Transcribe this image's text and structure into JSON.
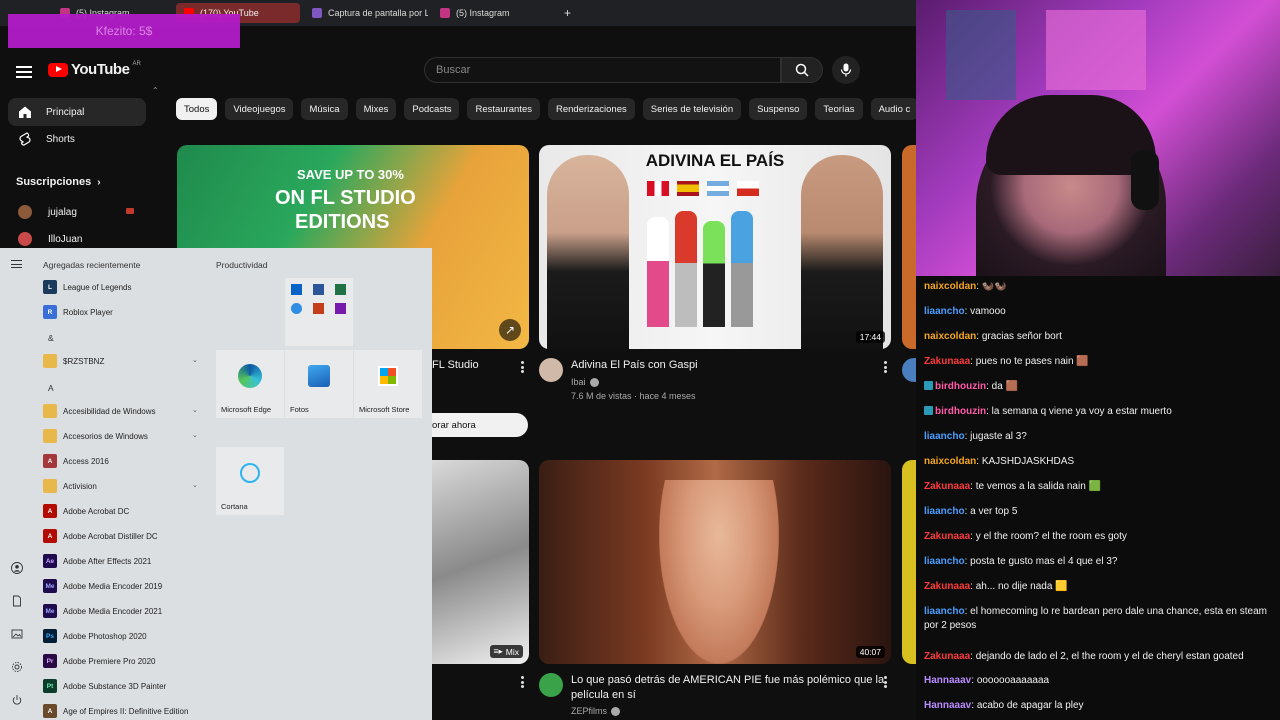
{
  "browser": {
    "tabs": [
      {
        "label": "(5) Instagram",
        "color": "#c13584"
      },
      {
        "label": "(170) YouTube",
        "color": "#ff0000",
        "active": true
      },
      {
        "label": "Captura de pantalla por Li",
        "color": "#7e57c2"
      },
      {
        "label": "(5) Instagram",
        "color": "#c13584"
      }
    ],
    "new_tab_label": "+"
  },
  "stream_overlay": "Kfezito: 5$",
  "youtube": {
    "logo_text": "YouTube",
    "region": "AR",
    "search_placeholder": "Buscar",
    "sidebar": {
      "items": [
        {
          "label": "Principal",
          "icon": "home-icon"
        },
        {
          "label": "Shorts",
          "icon": "shorts-icon"
        }
      ],
      "subscriptions_title": "Suscripciones",
      "subscriptions": [
        {
          "label": "jujalag",
          "color": "#8a5a3a"
        },
        {
          "label": "IlloJuan",
          "color": "#c94a4a"
        }
      ]
    },
    "chips": [
      "Todos",
      "Videojuegos",
      "Música",
      "Mixes",
      "Podcasts",
      "Restaurantes",
      "Renderizaciones",
      "Series de televisión",
      "Suspenso",
      "Teorías",
      "Audio c"
    ],
    "videos": [
      {
        "thumb_text_1": "SAVE UP TO 30%",
        "thumb_text_2": "ON FL STUDIO",
        "thumb_text_3": "EDITIONS",
        "title_partial": "FL Studio",
        "cta": "orar ahora"
      },
      {
        "thumb_text": "ADIVINA EL PAÍS",
        "duration": "17:44",
        "title": "Adivina El País con Gaspi",
        "channel": "Ibai",
        "meta": "7.6 M de vistas · hace 4 meses"
      },
      {
        "badge": "Mix"
      },
      {
        "duration": "40:07",
        "title_line1": "Lo que pasó detrás de AMERICAN PIE fue más polémico que la",
        "title_line2": "película en sí",
        "channel": "ZEPfilms"
      }
    ]
  },
  "start_menu": {
    "recent_header": "Agregadas recientemente",
    "productivity_header": "Productividad",
    "apps": [
      {
        "label": "League of Legends",
        "icon_color": "#1a3b5c",
        "glyph": "L"
      },
      {
        "label": "Roblox Player",
        "icon_color": "#3a6fd8",
        "glyph": "R"
      },
      {
        "label": "&",
        "type": "letter"
      },
      {
        "label": "$RZSTBNZ",
        "icon_color": "#e8b84a",
        "glyph": "",
        "folder": true
      },
      {
        "label": "A",
        "type": "letter"
      },
      {
        "label": "Accesibilidad de Windows",
        "icon_color": "#e8b84a",
        "glyph": "",
        "folder": true
      },
      {
        "label": "Accesorios de Windows",
        "icon_color": "#e8b84a",
        "glyph": "",
        "folder": true
      },
      {
        "label": "Access 2016",
        "icon_color": "#a4373a",
        "glyph": "A"
      },
      {
        "label": "Activision",
        "icon_color": "#e8b84a",
        "glyph": "",
        "folder": true
      },
      {
        "label": "Adobe Acrobat DC",
        "icon_color": "#b30b00",
        "glyph": "A"
      },
      {
        "label": "Adobe Acrobat Distiller DC",
        "icon_color": "#b30b00",
        "glyph": "A"
      },
      {
        "label": "Adobe After Effects 2021",
        "icon_color": "#1f0a4d",
        "glyph": "Ae"
      },
      {
        "label": "Adobe Media Encoder 2019",
        "icon_color": "#1f0a4d",
        "glyph": "Me"
      },
      {
        "label": "Adobe Media Encoder 2021",
        "icon_color": "#1f0a4d",
        "glyph": "Me"
      },
      {
        "label": "Adobe Photoshop 2020",
        "icon_color": "#001e36",
        "glyph": "Ps"
      },
      {
        "label": "Adobe Premiere Pro 2020",
        "icon_color": "#2a0a45",
        "glyph": "Pr"
      },
      {
        "label": "Adobe Substance 3D Painter",
        "icon_color": "#0b3d2a",
        "glyph": "Pt"
      },
      {
        "label": "Age of Empires II: Definitive Edition",
        "icon_color": "#6b4a2b",
        "glyph": "A"
      }
    ],
    "tiles": [
      {
        "label": "Microsoft Edge"
      },
      {
        "label": "Fotos"
      },
      {
        "label": "Microsoft Store"
      },
      {
        "label": "Cortana"
      }
    ]
  },
  "chat": {
    "messages": [
      {
        "user": "naixcoldan",
        "color": "#f5a623",
        "text": "🦦🦦"
      },
      {
        "user": "liaancho",
        "color": "#4a9eff",
        "text": "vamooo"
      },
      {
        "user": "naixcoldan",
        "color": "#f5a623",
        "text": "gracias señor bort"
      },
      {
        "user": "Zakunaaa",
        "color": "#ff3b3b",
        "text": "pues no te pases nain 🟫"
      },
      {
        "user": "birdhouzin",
        "color": "#ff5ca8",
        "text": "da 🟫",
        "badge": true
      },
      {
        "user": "birdhouzin",
        "color": "#ff5ca8",
        "text": "la semana q viene ya voy a estar muerto",
        "badge": true
      },
      {
        "user": "liaancho",
        "color": "#4a9eff",
        "text": "jugaste al 3?"
      },
      {
        "user": "naixcoldan",
        "color": "#f5a623",
        "text": "KAJSHDJASKHDAS"
      },
      {
        "user": "Zakunaaa",
        "color": "#ff3b3b",
        "text": "te vemos a la salida nain 🟩"
      },
      {
        "user": "liaancho",
        "color": "#4a9eff",
        "text": "a ver top 5"
      },
      {
        "user": "Zakunaaa",
        "color": "#ff3b3b",
        "text": "y el the room? el the room es goty"
      },
      {
        "user": "liaancho",
        "color": "#4a9eff",
        "text": "posta te gusto mas el 4 que el 3?"
      },
      {
        "user": "Zakunaaa",
        "color": "#ff3b3b",
        "text": "ah... no dije nada 🟨"
      },
      {
        "user": "liaancho",
        "color": "#4a9eff",
        "text": "el homecoming lo re bardean pero dale una chance, esta en steam por 2 pesos"
      },
      {
        "user": "Zakunaaa",
        "color": "#ff3b3b",
        "text": "dejando de lado el 2, el the room y el de cheryl estan goated"
      },
      {
        "user": "Hannaaav",
        "color": "#b98cff",
        "text": "ooooooaaaaaaa"
      },
      {
        "user": "Hannaaav",
        "color": "#b98cff",
        "text": "acabo de apagar la pley"
      }
    ]
  }
}
